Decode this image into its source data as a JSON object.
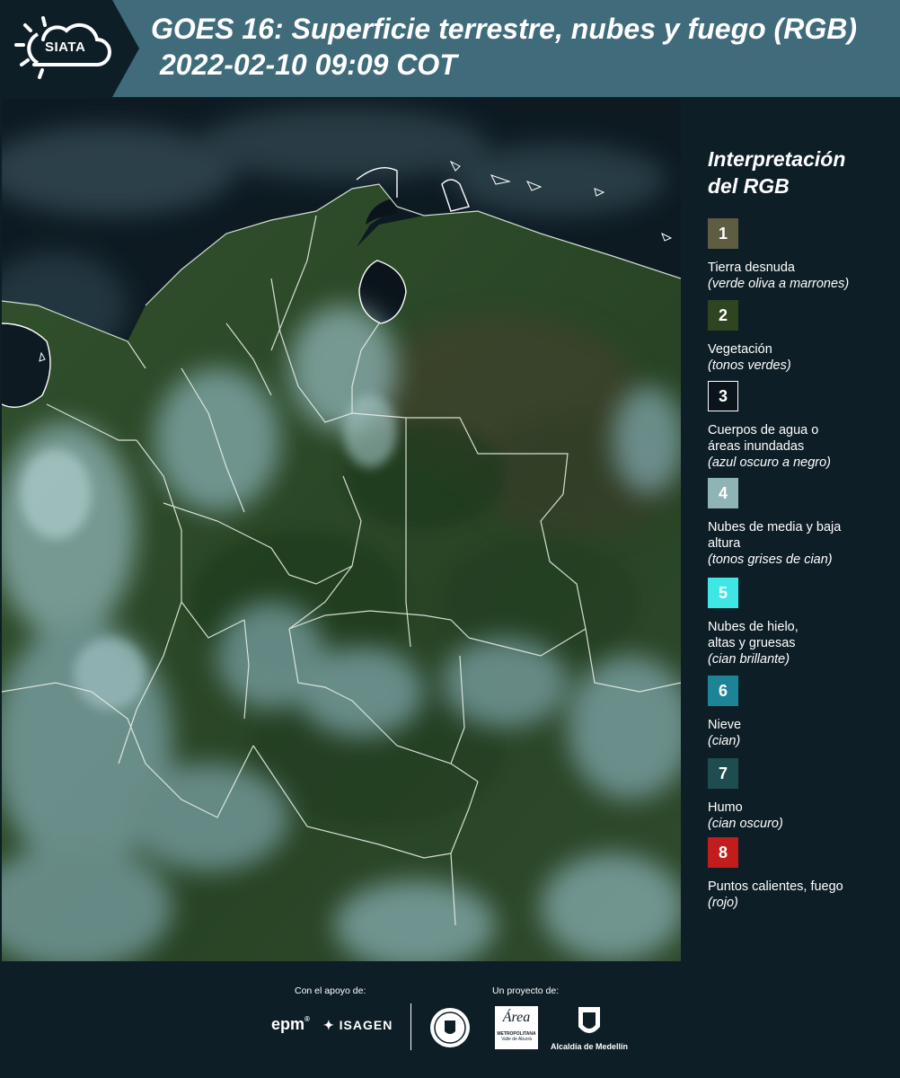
{
  "header": {
    "logo_text": "SIATA",
    "title_line1": "GOES 16: Superficie terrestre, nubes y fuego (RGB)",
    "title_line2": "2022-02-10 09:09 COT"
  },
  "legend": {
    "title_line1": "Interpretación",
    "title_line2": "del RGB",
    "items": [
      {
        "num": "1",
        "label": "Tierra desnuda",
        "sub": "(verde oliva a marrones)",
        "color": "#5e5c41"
      },
      {
        "num": "2",
        "label": "Vegetación",
        "sub": "(tonos verdes)",
        "color": "#2f4421"
      },
      {
        "num": "3",
        "label": "Cuerpos de agua o áreas inundadas",
        "sub": "(azul oscuro a negro)",
        "color": "#0b141b"
      },
      {
        "num": "4",
        "label": "Nubes de media y baja altura",
        "sub": "(tonos grises de cian)",
        "color": "#8fb4b6"
      },
      {
        "num": "5",
        "label": "Nubes de hielo, altas y gruesas",
        "sub": "(cian brillante)",
        "color": "#3ee6e4"
      },
      {
        "num": "6",
        "label": "Nieve",
        "sub": "(cian)",
        "color": "#1d8497"
      },
      {
        "num": "7",
        "label": "Humo",
        "sub": "(cian oscuro)",
        "color": "#1e4d50"
      },
      {
        "num": "8",
        "label": "Puntos calientes, fuego",
        "sub": "(rojo)",
        "color": "#c21c1c"
      }
    ]
  },
  "footer": {
    "support_label": "Con el apoyo de:",
    "project_label": "Un proyecto de:",
    "sponsor_epm": "epm",
    "sponsor_isagen": "ISAGEN",
    "area_metro_line1": "Área",
    "area_metro_line2": "METROPOLITANA",
    "area_metro_line3": "Valle de Aburrá",
    "alcaldia": "Alcaldía de Medellín"
  },
  "colors": {
    "header_bg": "#3f6b7a",
    "page_bg": "#0e1e27",
    "map_land": "#2d4a2a",
    "map_water": "#0b141b",
    "map_cloud": "#8fb4b6"
  }
}
